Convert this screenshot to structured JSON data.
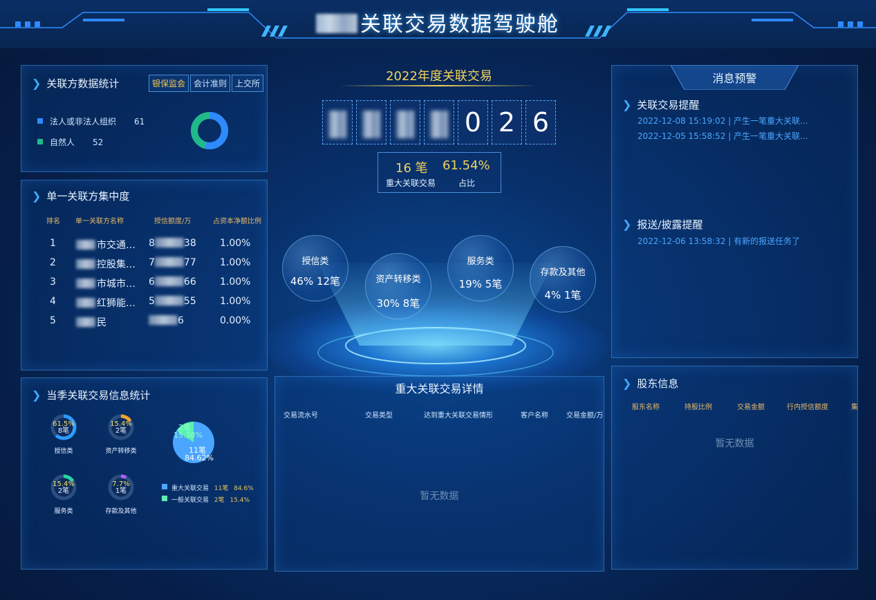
{
  "header": {
    "title": "关联交易数据驾驶舱"
  },
  "related_stats": {
    "title": "关联方数据统计",
    "tabs": [
      "银保监会",
      "会计准则",
      "上交所"
    ],
    "legend": [
      {
        "label": "法人或非法人组织",
        "value": "61",
        "color": "#2e8bff"
      },
      {
        "label": "自然人",
        "value": "52",
        "color": "#22b98a"
      }
    ]
  },
  "concentration": {
    "title": "单一关联方集中度",
    "headers": [
      "排名",
      "单一关联方名称",
      "授信额度/万",
      "占资本净额比例"
    ],
    "rows": [
      {
        "rank": "1",
        "name": "市交通…",
        "amount_prefix": "8",
        "amount_suffix": "38",
        "ratio": "1.00%"
      },
      {
        "rank": "2",
        "name": "控股集…",
        "amount_prefix": "7",
        "amount_suffix": "77",
        "ratio": "1.00%"
      },
      {
        "rank": "3",
        "name": "市城市…",
        "amount_prefix": "6",
        "amount_suffix": "66",
        "ratio": "1.00%"
      },
      {
        "rank": "4",
        "name": "红狮能…",
        "amount_prefix": "5",
        "amount_suffix": "55",
        "ratio": "1.00%"
      },
      {
        "rank": "5",
        "name": "民",
        "amount_prefix": "",
        "amount_suffix": "6",
        "ratio": "0.00%"
      }
    ]
  },
  "season": {
    "title": "当季关联交易信息统计",
    "donuts": [
      {
        "pct": "61.5%",
        "count": "8笔",
        "label": "授信类",
        "color": "#2e9bff",
        "fraction": 0.615
      },
      {
        "pct": "15.4%",
        "count": "2笔",
        "label": "资产转移类",
        "color": "#f2a22b",
        "fraction": 0.154
      },
      {
        "pct": "15.4%",
        "count": "2笔",
        "label": "服务类",
        "color": "#28d4a4",
        "fraction": 0.154
      },
      {
        "pct": "7.7%",
        "count": "1笔",
        "label": "存款及其他",
        "color": "#b25cff",
        "fraction": 0.077
      }
    ],
    "pie": {
      "small_count": "2笔",
      "small_pct": "15.38%",
      "big_count": "11笔",
      "big_pct": "84.62%"
    },
    "legend": [
      {
        "label": "重大关联交易",
        "count": "11笔",
        "pct": "84.6%",
        "color": "#4aa6ff"
      },
      {
        "label": "一般关联交易",
        "count": "2笔",
        "pct": "15.4%",
        "color": "#5cf0b0"
      }
    ]
  },
  "center": {
    "year_title": "2022年度关联交易",
    "digits": [
      "0",
      "2",
      "6"
    ],
    "major_count": "16 笔",
    "major_label": "重大关联交易",
    "ratio": "61.54%",
    "ratio_label": "占比",
    "bubbles": [
      {
        "label": "授信类",
        "pct": "46%",
        "count": "12笔"
      },
      {
        "label": "资产转移类",
        "pct": "30%",
        "count": "8笔"
      },
      {
        "label": "服务类",
        "pct": "19%",
        "count": "5笔"
      },
      {
        "label": "存款及其他",
        "pct": "4%",
        "count": "1笔"
      }
    ]
  },
  "major_detail": {
    "title": "重大关联交易详情",
    "headers": [
      "交易流水号",
      "交易类型",
      "达到重大关联交易情形",
      "客户名称",
      "交易金额/万"
    ],
    "empty": "暂无数据"
  },
  "alerts": {
    "title": "消息预警",
    "section1_title": "关联交易提醒",
    "section1_items": [
      {
        "time": "2022-12-08 15:19:02",
        "text": "产生一笔重大关联..."
      },
      {
        "time": "2022-12-05 15:58:52",
        "text": "产生一笔重大关联..."
      }
    ],
    "section2_title": "报送/披露提醒",
    "section2_items": [
      {
        "time": "2022-12-06 13:58:32",
        "text": "有新的报送任务了"
      }
    ]
  },
  "shareholders": {
    "title": "股东信息",
    "headers": [
      "股东名称",
      "持股比例",
      "交易金额",
      "行内授信额度",
      "集"
    ],
    "empty": "暂无数据"
  }
}
